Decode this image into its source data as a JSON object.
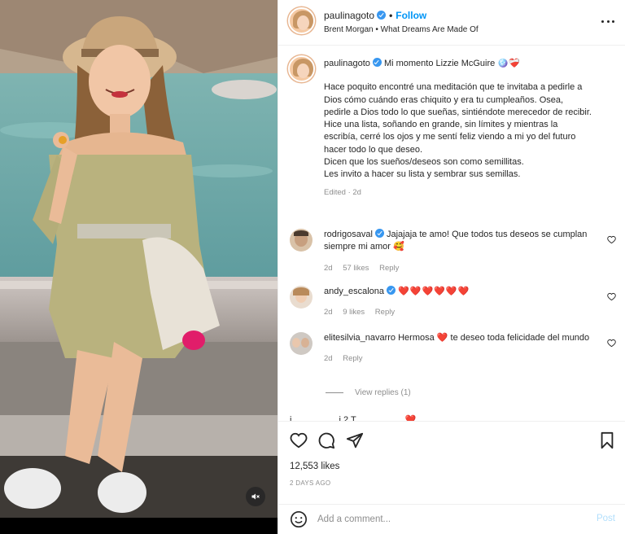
{
  "post_header": {
    "username": "paulinagoto",
    "follow_label": "Follow",
    "audio": "Brent Morgan • What Dreams Are Made Of"
  },
  "caption": {
    "username": "paulinagoto",
    "title": "Mi momento Lizzie McGuire 🪩❤️‍🩹",
    "lines": [
      "Hace poquito encontré una meditación que te invitaba a pedirle a Dios cómo cuándo eras chiquito y era tu cumpleaños. Osea, pedirle a Dios todo lo que sueñas, sintiéndote merecedor de recibir.",
      "Hice una lista, soñando en grande, sin límites y mientras la escribía, cerré los ojos y me sentí feliz viendo a mi yo del futuro hacer todo lo que deseo.",
      "Dicen que los sueños/deseos son como semillitas.",
      "Les invito a hacer su lista y sembrar sus semillas."
    ],
    "edited": "Edited",
    "age": "2d"
  },
  "comments": [
    {
      "username": "rodrigosaval",
      "text": "Jajajaja te amo! Que todos tus deseos se cumplan siempre mi amor 🥰",
      "age": "2d",
      "likes": "57 likes",
      "reply": "Reply"
    },
    {
      "username": "andy_escalona",
      "text": "❤️❤️❤️❤️❤️❤️",
      "age": "2d",
      "likes": "9 likes",
      "reply": "Reply"
    },
    {
      "username": "elitesilvia_navarro",
      "text": "Hermosa ❤️ te deseo toda felicidade del mundo",
      "age": "2d",
      "reply": "Reply",
      "view_replies": "View replies (1)"
    }
  ],
  "peek_text": "i... ... ... ... ...i 2 T... ... ... ... ... ❤️",
  "actions": {
    "likes": "12,553 likes",
    "date": "2 DAYS AGO"
  },
  "composer": {
    "placeholder": "Add a comment...",
    "post_label": "Post"
  },
  "colors": {
    "link_blue": "#0095f6",
    "heart_red": "#ed4956",
    "muted": "#8e8e8e"
  }
}
